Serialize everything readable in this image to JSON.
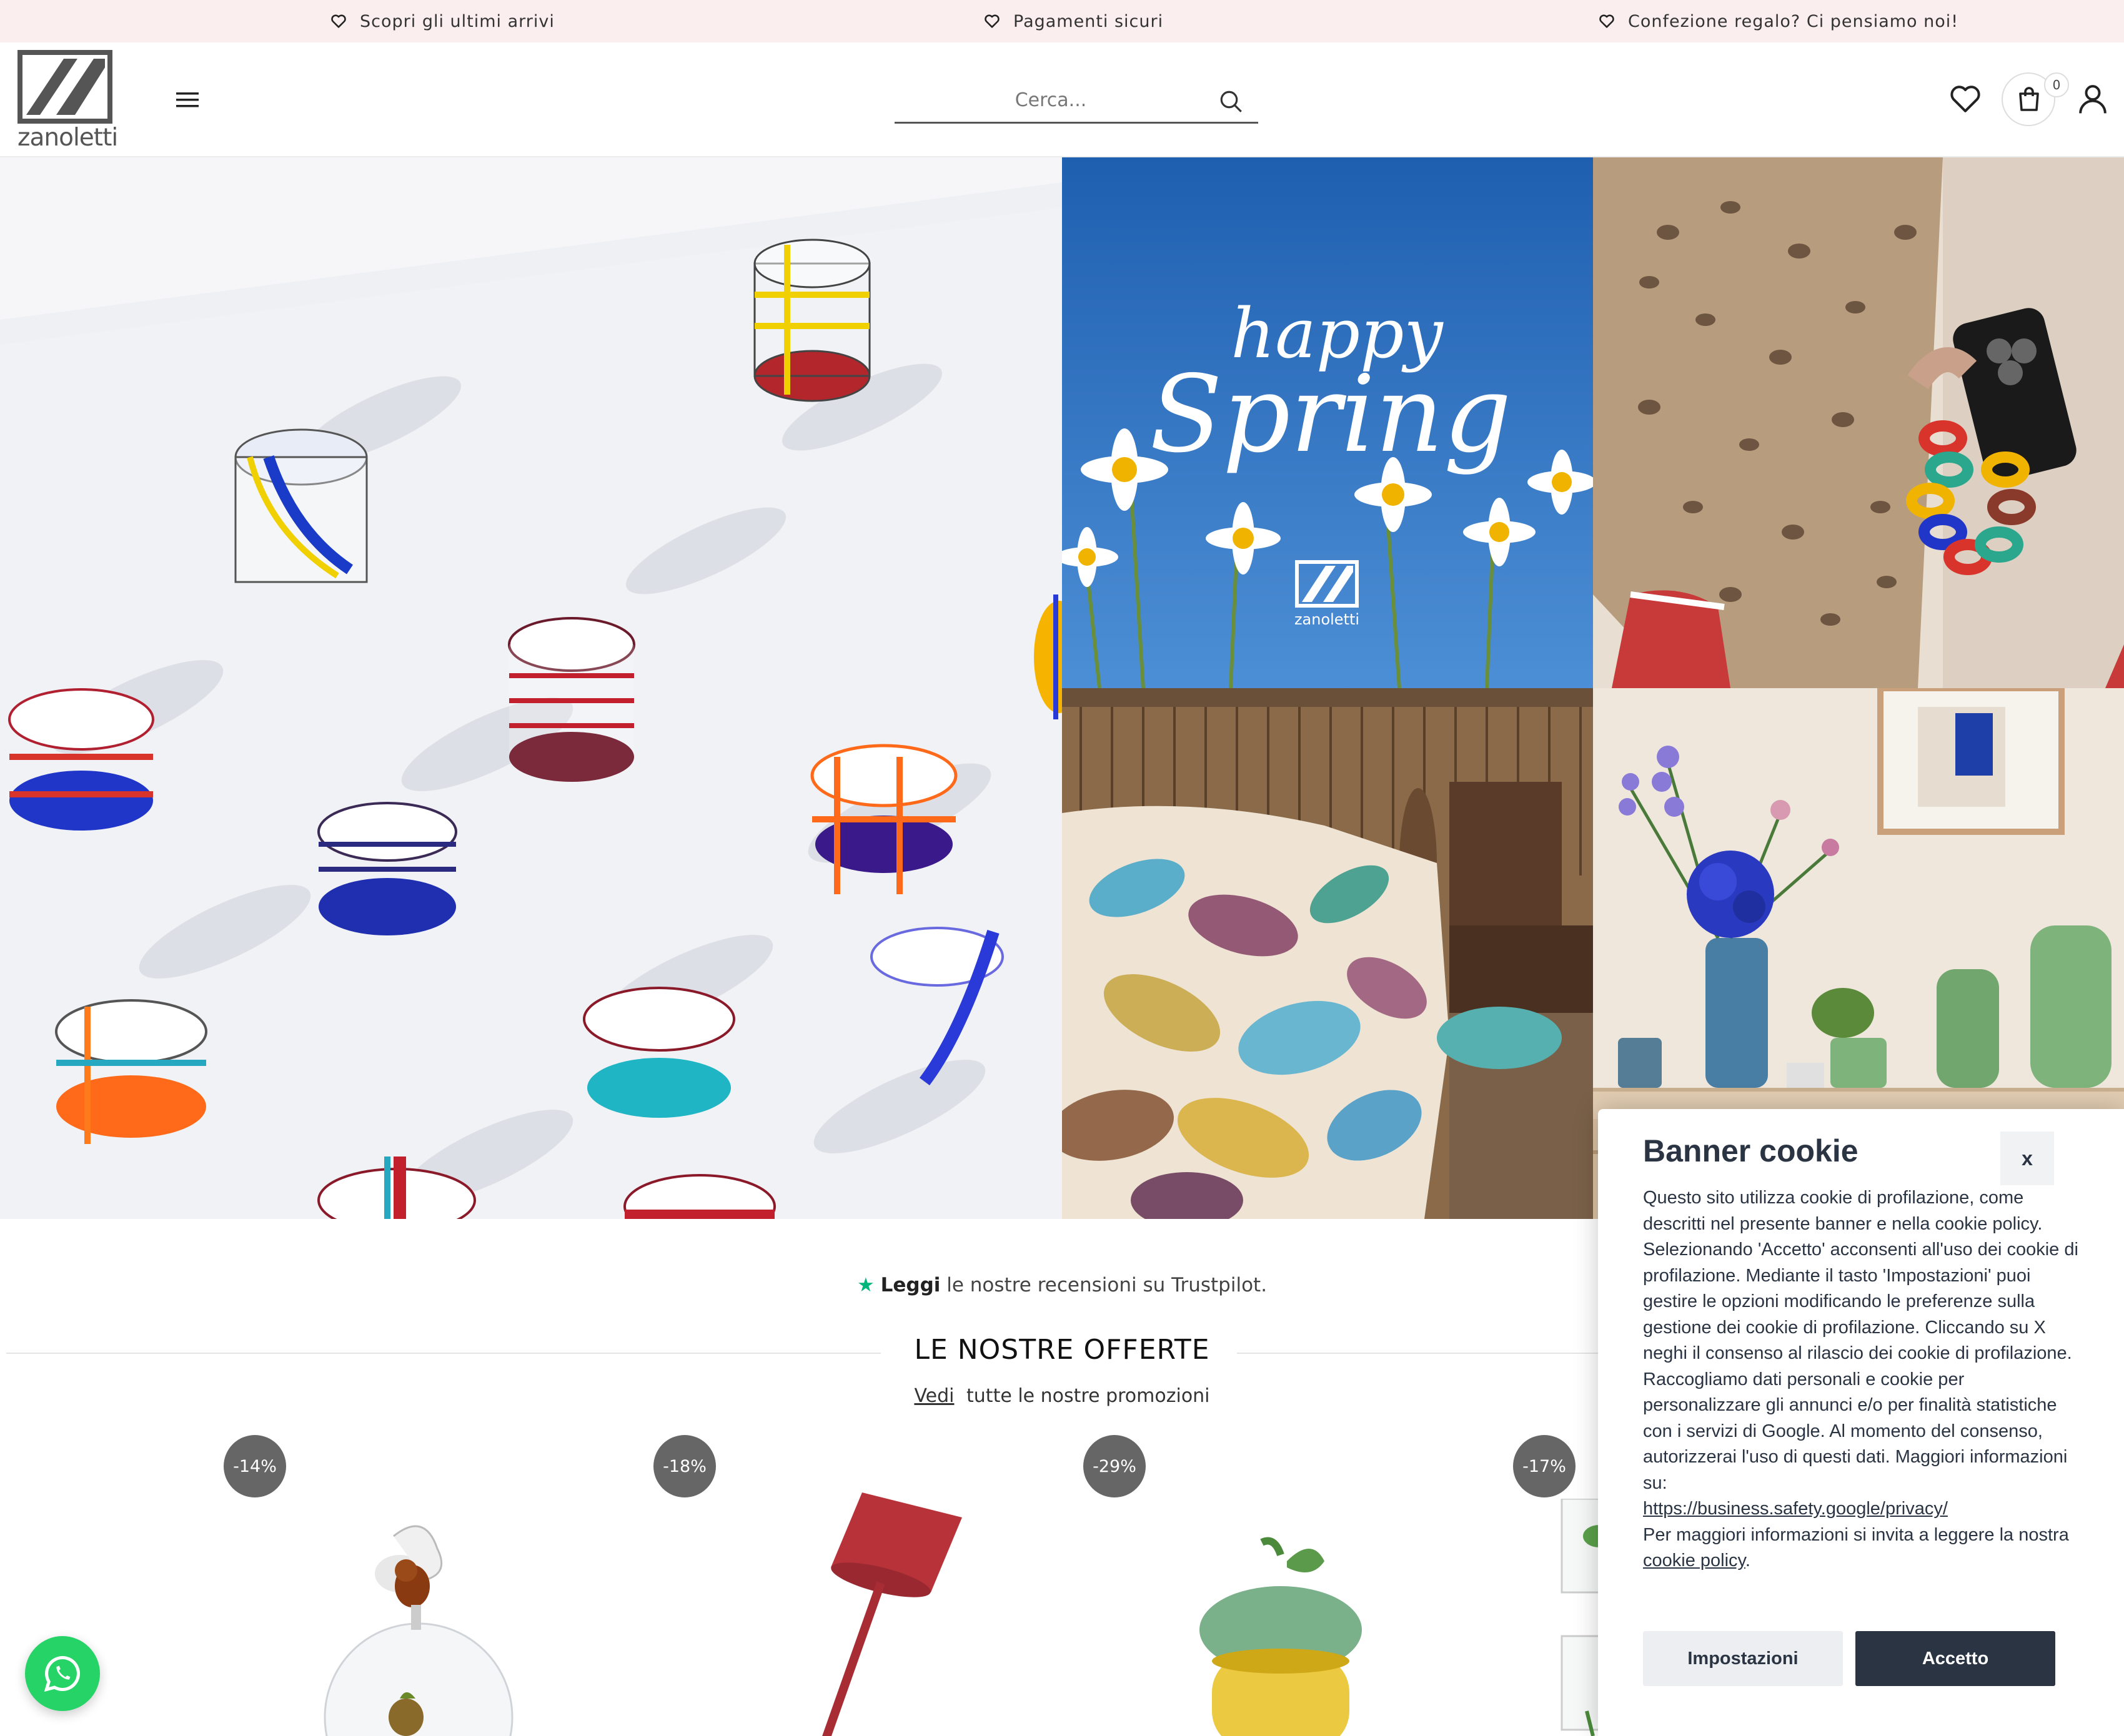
{
  "announcement": {
    "items": [
      {
        "text": "Scopri gli ultimi arrivi",
        "icon": "heart-icon"
      },
      {
        "text": "Pagamenti sicuri",
        "icon": "heart-icon"
      },
      {
        "text": "Confezione regalo? Ci pensiamo noi!",
        "icon": "heart-icon"
      }
    ]
  },
  "header": {
    "logo_text": "zanoletti",
    "menu_icon": "hamburger-menu-icon",
    "search_placeholder": "Cerca...",
    "cart_count": "0",
    "icons": [
      "search-icon",
      "heart-icon",
      "shopping-bag-icon",
      "user-icon"
    ]
  },
  "hero": {
    "spring_line1": "happy",
    "spring_line2": "Spring",
    "spring_logo": "zanoletti"
  },
  "trustpilot": {
    "bold": "Leggi",
    "text": " le nostre recensioni su Trustpilot."
  },
  "offers": {
    "title": "LE NOSTRE OFFERTE",
    "link": "Vedi",
    "subtitle": "tutte le nostre promozioni",
    "badges": [
      "-14%",
      "-18%",
      "-29%",
      "-17%"
    ]
  },
  "cookie_banner": {
    "title": "Banner cookie",
    "close_label": "x",
    "paragraph1": "Questo sito utilizza cookie di profilazione, come descritti nel presente banner e nella cookie policy. Selezionando 'Accetto' acconsenti all'uso dei cookie di profilazione. Mediante il tasto 'Impostazioni' puoi gestire le opzioni modificando le preferenze sulla gestione dei cookie di profilazione. Cliccando su X neghi il consenso al rilascio dei cookie di profilazione.",
    "paragraph2": "Raccogliamo dati personali e cookie per personalizzare gli annunci e/o per finalità statistiche con i servizi di Google. Al momento del consenso, autorizzerai l'uso di questi dati. Maggiori informazioni su:",
    "google_link": "https://business.safety.google/privacy/",
    "paragraph3": "Per maggiori informazioni si invita a leggere la nostra ",
    "policy_link": "cookie policy",
    "paragraph3_end": ".",
    "settings_label": "Impostazioni",
    "accept_label": "Accetto"
  },
  "colors": {
    "topbar_bg": "#fbeeee",
    "cookie_dark": "#2a3443",
    "badge_gray": "#666666",
    "whatsapp_green": "#25d366",
    "trustpilot_green": "#00b67a"
  }
}
